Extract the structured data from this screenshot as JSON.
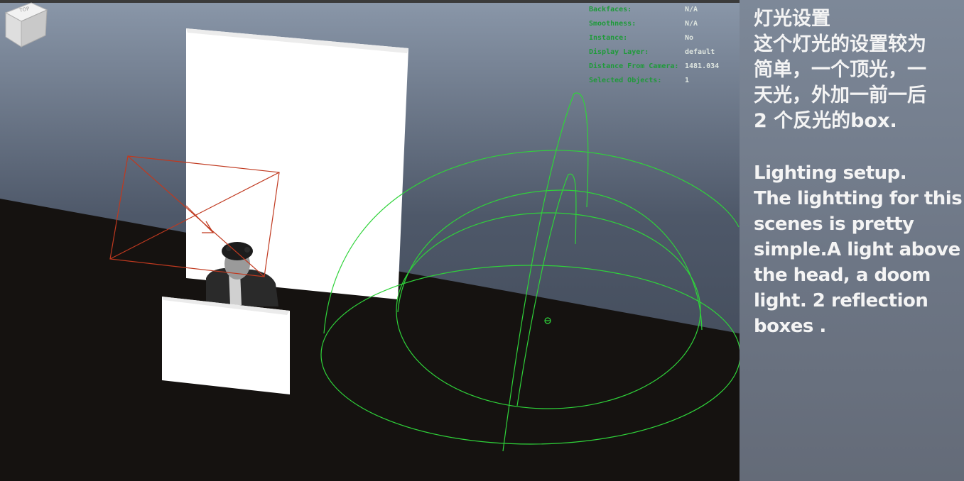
{
  "hud": {
    "rows": [
      {
        "label": "Backfaces:",
        "value": "N/A"
      },
      {
        "label": "Smoothness:",
        "value": "N/A"
      },
      {
        "label": "Instance:",
        "value": "No"
      },
      {
        "label": "Display Layer:",
        "value": "default"
      },
      {
        "label": "Distance From Camera:",
        "value": "1481.034"
      },
      {
        "label": "Selected Objects:",
        "value": "1"
      }
    ]
  },
  "viewcube": {
    "face_label": "TOP"
  },
  "notes": {
    "chinese": {
      "title": "灯光设置",
      "lines": [
        "这个灯光的设置较为",
        "简单，一个顶光，一",
        "天光，外加一前一后",
        "2 个反光的box."
      ]
    },
    "english": {
      "title": "Lighting setup.",
      "lines": [
        "The lightting for this",
        "scenes is pretty",
        "simple.A light above",
        "the head, a doom",
        "light. 2 reflection",
        "boxes ."
      ]
    }
  },
  "colors": {
    "sky_top": "#8a97a9",
    "ground": "#151210",
    "dome_light": "#2fd33a",
    "area_light": "#c0391f",
    "reflector": "#ffffff"
  }
}
